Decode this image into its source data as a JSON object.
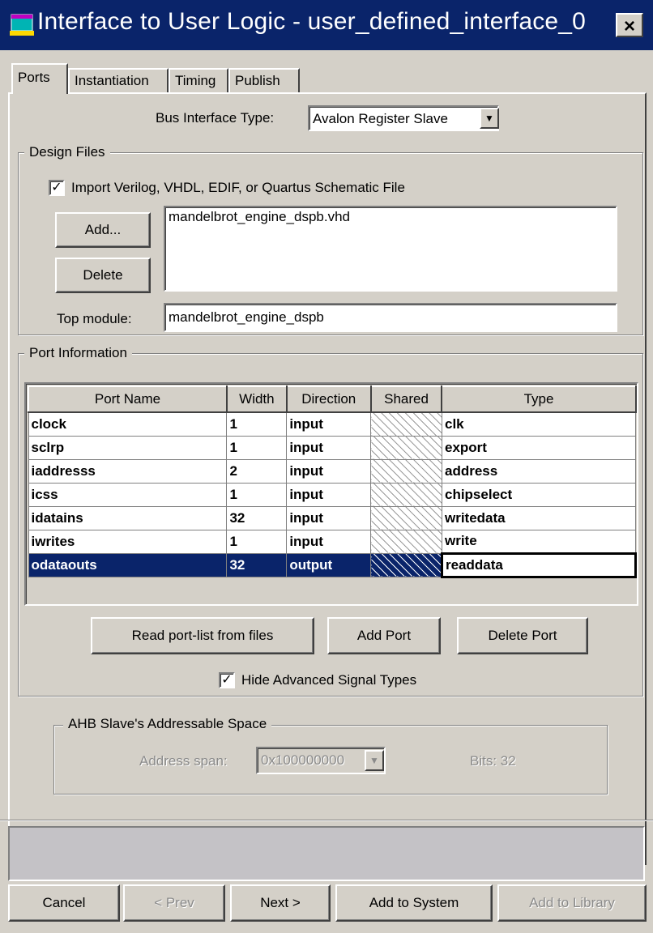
{
  "window": {
    "title": "Interface to User Logic - user_defined_interface_0",
    "close_glyph": "×",
    "icon": "app-window-icon"
  },
  "tabs": [
    {
      "label": "Ports",
      "active": true
    },
    {
      "label": "Instantiation",
      "active": false
    },
    {
      "label": "Timing",
      "active": false
    },
    {
      "label": "Publish",
      "active": false
    }
  ],
  "bus_interface": {
    "label": "Bus Interface Type:",
    "value": "Avalon Register Slave"
  },
  "design_files": {
    "legend": "Design Files",
    "import_checkbox_label": "Import Verilog, VHDL, EDIF, or Quartus Schematic File",
    "import_checked": true,
    "add_button": "Add...",
    "delete_button": "Delete",
    "files": [
      "mandelbrot_engine_dspb.vhd"
    ],
    "top_module_label": "Top module:",
    "top_module_value": "mandelbrot_engine_dspb"
  },
  "port_information": {
    "legend": "Port Information",
    "columns": [
      "Port Name",
      "Width",
      "Direction",
      "Shared",
      "Type"
    ],
    "rows": [
      {
        "name": "clock",
        "width": "1",
        "direction": "input",
        "type": "clk"
      },
      {
        "name": "sclrp",
        "width": "1",
        "direction": "input",
        "type": "export"
      },
      {
        "name": "iaddresss",
        "width": "2",
        "direction": "input",
        "type": "address"
      },
      {
        "name": "icss",
        "width": "1",
        "direction": "input",
        "type": "chipselect"
      },
      {
        "name": "idatains",
        "width": "32",
        "direction": "input",
        "type": "writedata"
      },
      {
        "name": "iwrites",
        "width": "1",
        "direction": "input",
        "type": "write"
      },
      {
        "name": "odataouts",
        "width": "32",
        "direction": "output",
        "type": "readdata",
        "selected": true
      }
    ],
    "read_ports_button": "Read port-list from files",
    "add_port_button": "Add Port",
    "delete_port_button": "Delete Port",
    "hide_advanced_label": "Hide Advanced Signal Types",
    "hide_advanced_checked": true
  },
  "ahb": {
    "legend": "AHB Slave's Addressable Space",
    "address_span_label": "Address span:",
    "address_span_value": "0x100000000",
    "bits_label": "Bits: 32"
  },
  "footer": {
    "cancel": "Cancel",
    "prev": "< Prev",
    "next": "Next >",
    "add_to_system": "Add to System",
    "add_to_library": "Add to Library"
  },
  "colors": {
    "titlebar": "#0a246a",
    "face": "#d4d0c8",
    "selection": "#0a246a"
  }
}
